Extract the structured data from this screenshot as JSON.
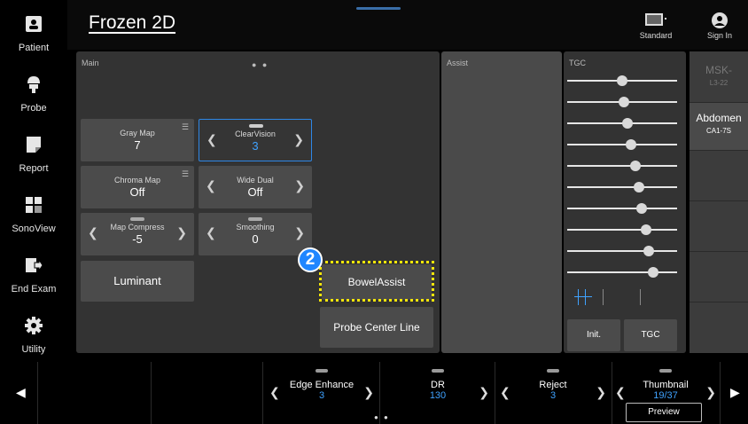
{
  "sidebar": {
    "items": [
      {
        "label": "Patient",
        "icon": "patient-icon"
      },
      {
        "label": "Probe",
        "icon": "probe-icon"
      },
      {
        "label": "Report",
        "icon": "report-icon"
      },
      {
        "label": "SonoView",
        "icon": "sonoview-icon"
      },
      {
        "label": "End Exam",
        "icon": "end-exam-icon"
      },
      {
        "label": "Utility",
        "icon": "gear-icon"
      }
    ]
  },
  "header": {
    "title": "Frozen 2D",
    "standard_label": "Standard",
    "signin_label": "Sign In"
  },
  "main": {
    "label": "Main",
    "page_dots": "● ●",
    "controls": {
      "gray_map": {
        "name": "Gray Map",
        "value": "7"
      },
      "clearvision": {
        "name": "ClearVision",
        "value": "3"
      },
      "chroma_map": {
        "name": "Chroma Map",
        "value": "Off"
      },
      "wide_dual": {
        "name": "Wide Dual",
        "value": "Off"
      },
      "map_compress": {
        "name": "Map Compress",
        "value": "-5"
      },
      "smoothing": {
        "name": "Smoothing",
        "value": "0"
      }
    },
    "luminant_label": "Luminant",
    "bowel_assist_label": "BowelAssist",
    "probe_center_line_label": "Probe Center Line",
    "callout_number": "2"
  },
  "assist": {
    "label": "Assist"
  },
  "tgc": {
    "label": "TGC",
    "slider_levels": [
      0.5,
      0.52,
      0.55,
      0.58,
      0.62,
      0.65,
      0.68,
      0.72,
      0.74,
      0.78
    ],
    "init_label": "Init.",
    "tgc_button_label": "TGC"
  },
  "probes": [
    {
      "name": "MSK-",
      "sub": "L3-22",
      "active": false
    },
    {
      "name": "Abdomen",
      "sub": "CA1-7S",
      "active": true
    }
  ],
  "bottom": {
    "controls": [
      {
        "name": "Edge Enhance",
        "value": "3"
      },
      {
        "name": "DR",
        "value": "130"
      },
      {
        "name": "Reject",
        "value": "3"
      },
      {
        "name": "Thumbnail",
        "value": "19/37"
      }
    ],
    "preview_label": "Preview",
    "page_dots": "● ●"
  },
  "colors": {
    "accent": "#2e87e6",
    "value_blue": "#3fa2ff",
    "highlight": "#f5e60a",
    "callout": "#1f86ff"
  }
}
